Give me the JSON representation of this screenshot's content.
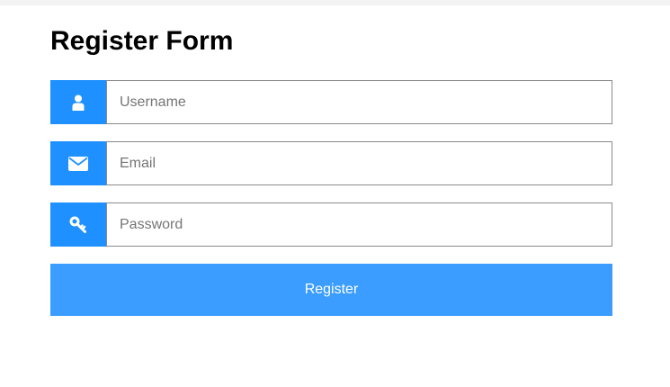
{
  "form": {
    "title": "Register Form",
    "accent_color": "#1e90ff",
    "button_color": "#3a9dff",
    "fields": [
      {
        "icon": "user-icon",
        "placeholder": "Username",
        "value": ""
      },
      {
        "icon": "envelope-icon",
        "placeholder": "Email",
        "value": ""
      },
      {
        "icon": "key-icon",
        "placeholder": "Password",
        "value": ""
      }
    ],
    "submit_label": "Register"
  }
}
